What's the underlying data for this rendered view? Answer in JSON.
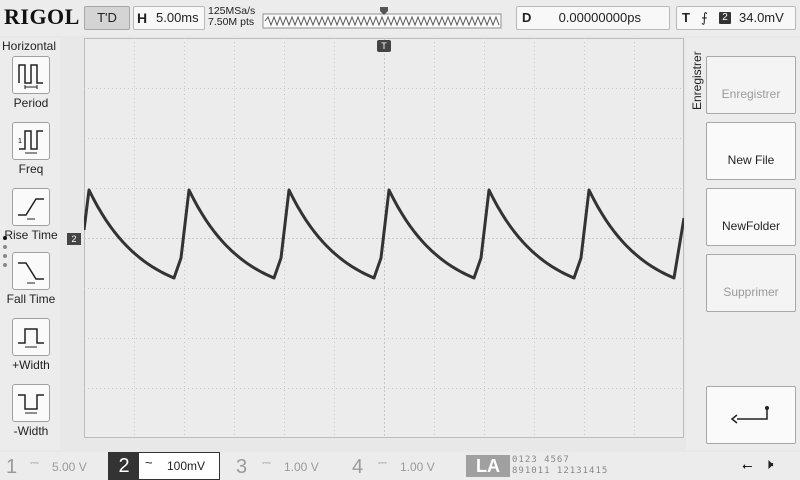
{
  "header": {
    "logo": "RIGOL",
    "run_status": "T'D",
    "horizontal": {
      "tag": "H",
      "timebase": "5.00ms"
    },
    "sample_rate": "125MSa/s",
    "memory_depth": "7.50M pts",
    "delay": {
      "tag": "D",
      "value": "0.00000000ps"
    },
    "trigger": {
      "tag": "T",
      "edge_symbol": "⨍",
      "source": "2",
      "level": "34.0mV"
    }
  },
  "left_menu": {
    "title": "Horizontal",
    "items": [
      {
        "label": "Period",
        "icon": "period-icon"
      },
      {
        "label": "Freq",
        "icon": "freq-icon"
      },
      {
        "label": "Rise Time",
        "icon": "rise-time-icon"
      },
      {
        "label": "Fall Time",
        "icon": "fall-time-icon"
      },
      {
        "label": "+Width",
        "icon": "positive-width-icon"
      },
      {
        "label": "-Width",
        "icon": "negative-width-icon"
      }
    ]
  },
  "right_menu": {
    "title": "Enregistrer",
    "buttons": [
      {
        "label": "Enregistrer",
        "enabled": false
      },
      {
        "label": "New File",
        "enabled": true
      },
      {
        "label": "NewFolder",
        "enabled": true
      },
      {
        "label": "Supprimer",
        "enabled": false
      }
    ],
    "back_icon": "return-arrow-icon"
  },
  "grid_markers": {
    "trigger_pos": "T",
    "channel_marker": "2",
    "trigger_level_marker": "T"
  },
  "channels": [
    {
      "num": "1",
      "coupling": "⎓",
      "scale": "5.00 V"
    },
    {
      "num": "2",
      "coupling": "~",
      "scale": "100mV"
    },
    {
      "num": "3",
      "coupling": "⎓",
      "scale": "1.00 V"
    },
    {
      "num": "4",
      "coupling": "⎓",
      "scale": "1.00 V"
    }
  ],
  "la": {
    "label": "LA",
    "row1": "0123 4567",
    "row2": "891011 12131415"
  },
  "status_icons": {
    "usb": "usb-icon",
    "speaker": "speaker-muted-icon"
  },
  "colors": {
    "grid": "#c8c8c8",
    "trace": "#333333",
    "background": "#e8e8e8"
  }
}
